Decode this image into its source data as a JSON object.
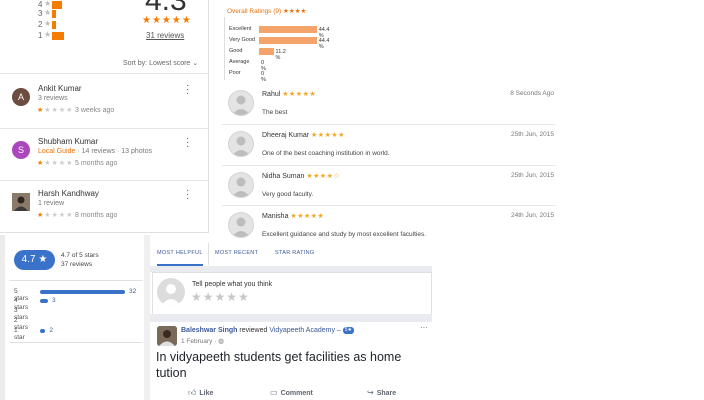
{
  "google": {
    "histogram": [
      {
        "label": "4",
        "fill": 0.12
      },
      {
        "label": "3",
        "fill": 0.05
      },
      {
        "label": "2",
        "fill": 0.05
      },
      {
        "label": "1",
        "fill": 0.15
      }
    ],
    "average": "4.3",
    "stars": "★★★★★",
    "reviews_link": "31 reviews",
    "sort_label": "Sort by:",
    "sort_value": "Lowest score",
    "reviews": [
      {
        "initial": "A",
        "avatar_color": "#6d4c41",
        "name": "Ankit Kumar",
        "sub": "3 reviews",
        "local_guide": "",
        "rating": 1,
        "time": "3 weeks ago"
      },
      {
        "initial": "S",
        "avatar_color": "#ab47bc",
        "name": "Shubham Kumar",
        "sub": "· 14 reviews · 13 photos",
        "local_guide": "Local Guide",
        "rating": 1,
        "time": "5 months ago"
      },
      {
        "initial": "",
        "avatar_color": "#5d4a3a",
        "name": "Harsh Kandhway",
        "sub": "1 review",
        "local_guide": "",
        "rating": 1,
        "time": "8 months ago"
      }
    ]
  },
  "overall": {
    "title": "Overall Ratings (9)",
    "title_stars": "★★★★",
    "rows": [
      {
        "label": "Excellent",
        "pct": "44.4 %",
        "value": 44.4
      },
      {
        "label": "Very Good",
        "pct": "44.4 %",
        "value": 44.4
      },
      {
        "label": "Good",
        "pct": "11.2 %",
        "value": 11.2
      },
      {
        "label": "Average",
        "pct": "0 %",
        "value": 0
      },
      {
        "label": "Poor",
        "pct": "0 %",
        "value": 0
      }
    ]
  },
  "site_reviews": [
    {
      "name": "Rahul",
      "stars": "★★★★★",
      "date": "8 Seconds Ago",
      "text": "The best"
    },
    {
      "name": "Dheeraj Kumar",
      "stars": "★★★★★",
      "date": "25th Jun, 2015",
      "text": "One of the best coaching institution in world."
    },
    {
      "name": "Nidha Suman",
      "stars": "★★★★☆",
      "date": "25th Jun, 2015",
      "text": "Very good faculty."
    },
    {
      "name": "Manisha",
      "stars": "★★★★★",
      "date": "24th Jun, 2015",
      "text": "Excellent guidance and study by most excellent faculties."
    }
  ],
  "fb_summary": {
    "score": "4.7 ★",
    "caption1": "4.7 of 5 stars",
    "caption2": "37 reviews",
    "rows": [
      {
        "label": "5 stars",
        "count": "32",
        "value": 32
      },
      {
        "label": "4 stars",
        "count": "3",
        "value": 3
      },
      {
        "label": "3 stars",
        "count": "",
        "value": 0
      },
      {
        "label": "2 stars",
        "count": "",
        "value": 0
      },
      {
        "label": "1 star",
        "count": "2",
        "value": 2
      }
    ],
    "max": 32
  },
  "tabs": [
    "MOST HELPFUL",
    "MOST RECENT",
    "STAR RATING"
  ],
  "tell": {
    "text": "Tell people what you think",
    "stars": "★★★★★"
  },
  "post": {
    "author": "Baleshwar Singh",
    "reviewed": "reviewed",
    "page": "Vidyapeeth Academy –",
    "badge": "5★",
    "date": "1 February · ",
    "globe": "◍",
    "menu": "···",
    "body": "In vidyapeeth students get facilities as home tution",
    "actions": [
      {
        "icon": "👍︎",
        "label": "Like"
      },
      {
        "icon": "▭",
        "label": "Comment"
      },
      {
        "icon": "↪",
        "label": "Share"
      }
    ]
  },
  "colors": {
    "orange": "#f57c00",
    "fb_blue": "#3b72c9",
    "bar_peach": "#f4a36b"
  }
}
